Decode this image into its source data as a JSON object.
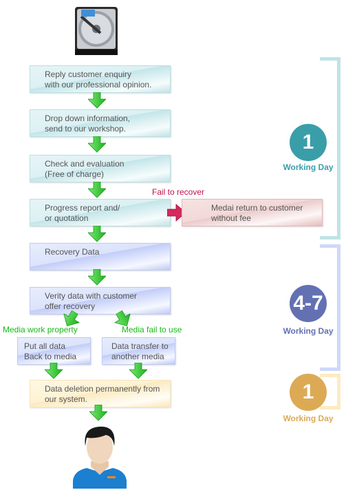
{
  "steps": {
    "reply": [
      "Reply customer enquiry",
      "with our professional opinion."
    ],
    "dropdown": [
      "Drop down information,",
      "send to our workshop."
    ],
    "check": [
      "Check and evaluation",
      "(Free of charge)"
    ],
    "progress": [
      "Progress report and/",
      "or quotation"
    ],
    "fail_label": "Fail to recover",
    "fail_box": [
      "Medai return to customer",
      "without fee"
    ],
    "recovery": [
      "Recovery Data"
    ],
    "verify": [
      "Verity data with customer",
      "offer recovery"
    ],
    "branch_left_label": "Media work property",
    "branch_right_label": "Media fail to use",
    "put_back": [
      "Put all data",
      "Back to media"
    ],
    "transfer": [
      "Data transfer to",
      "another media"
    ],
    "deletion": [
      "Data deletion permanently from",
      "our system."
    ]
  },
  "timeline": [
    {
      "number": "1",
      "label": "Working Day",
      "color": "#3a9ea8",
      "bracket_color": "#bfe3e6"
    },
    {
      "number": "4-7",
      "label": "Working Day",
      "color": "#6371b3",
      "bracket_color": "#cfd8f8"
    },
    {
      "number": "1",
      "label": "Working Day",
      "color": "#dcaa55",
      "bracket_color": "#fcecc2"
    }
  ],
  "icons": {
    "top": "hard-drive-icon",
    "bottom": "customer-person-icon",
    "flow": "green-down-arrow-icon",
    "fail": "red-right-arrow-icon"
  }
}
